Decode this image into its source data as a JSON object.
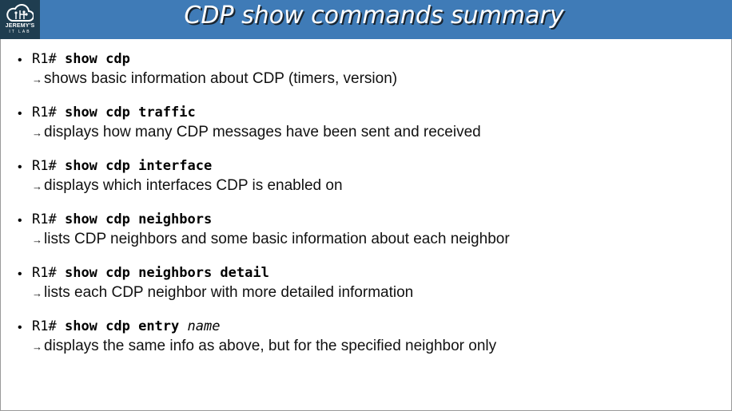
{
  "header": {
    "title": "CDP show commands summary",
    "logo": {
      "line1": "JEREMY'S",
      "line2": "IT LAB"
    }
  },
  "items": [
    {
      "prompt": "R1#",
      "command": "show cdp",
      "arg": "",
      "description": "shows basic information about CDP (timers, version)"
    },
    {
      "prompt": "R1#",
      "command": "show cdp traffic",
      "arg": "",
      "description": "displays how many CDP messages have been sent and received"
    },
    {
      "prompt": "R1#",
      "command": "show cdp interface",
      "arg": "",
      "description": "displays which interfaces CDP is enabled on"
    },
    {
      "prompt": "R1#",
      "command": "show cdp neighbors",
      "arg": "",
      "description": "lists CDP neighbors and some basic information about each neighbor"
    },
    {
      "prompt": "R1#",
      "command": "show cdp neighbors detail",
      "arg": "",
      "description": "lists each CDP neighbor with more detailed information"
    },
    {
      "prompt": "R1#",
      "command": "show cdp entry",
      "arg": "name",
      "description": "displays the same info as above, but for the specified neighbor only"
    }
  ],
  "arrow_symbol": "→",
  "bullet_symbol": "•"
}
